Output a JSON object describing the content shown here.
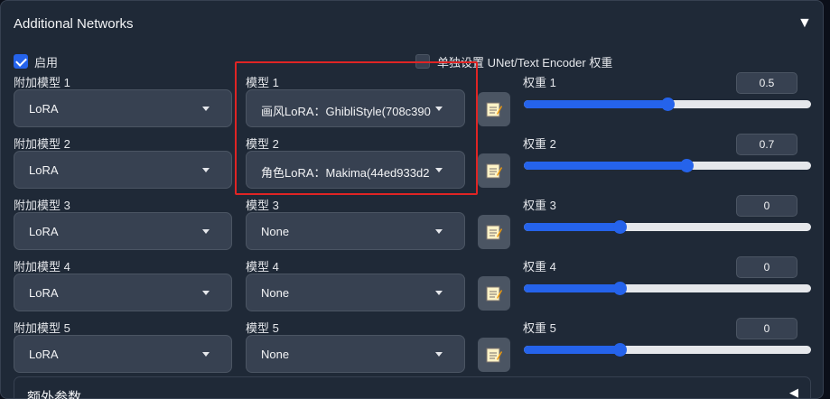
{
  "panel": {
    "title": "Additional Networks",
    "collapse_glyph": "▼"
  },
  "enable": {
    "label": "启用",
    "checked": true
  },
  "separate_unet": {
    "label": "单独设置 UNet/Text Encoder 权重",
    "checked": false
  },
  "rows": [
    {
      "addl_label": "附加模型 1",
      "addl_value": "LoRA",
      "model_label": "模型 1",
      "model_value": "画风LoRA：GhibliStyle(708c390",
      "weight_label": "权重 1",
      "weight": "0.5",
      "weight_fraction": 0.5
    },
    {
      "addl_label": "附加模型 2",
      "addl_value": "LoRA",
      "model_label": "模型 2",
      "model_value": "角色LoRA：Makima(44ed933d2",
      "weight_label": "权重 2",
      "weight": "0.7",
      "weight_fraction": 0.567
    },
    {
      "addl_label": "附加模型 3",
      "addl_value": "LoRA",
      "model_label": "模型 3",
      "model_value": "None",
      "weight_label": "权重 3",
      "weight": "0",
      "weight_fraction": 0.333
    },
    {
      "addl_label": "附加模型 4",
      "addl_value": "LoRA",
      "model_label": "模型 4",
      "model_value": "None",
      "weight_label": "权重 4",
      "weight": "0",
      "weight_fraction": 0.333
    },
    {
      "addl_label": "附加模型 5",
      "addl_value": "LoRA",
      "model_label": "模型 5",
      "model_value": "None",
      "weight_label": "权重 5",
      "weight": "0",
      "weight_fraction": 0.333
    }
  ],
  "extra_params": {
    "label": "额外参数",
    "glyph": "◀"
  },
  "icons": {
    "note_button": "notepad-icon"
  },
  "colors": {
    "accent": "#2563eb",
    "highlight": "#e02424",
    "panel_bg": "#1f2937"
  }
}
